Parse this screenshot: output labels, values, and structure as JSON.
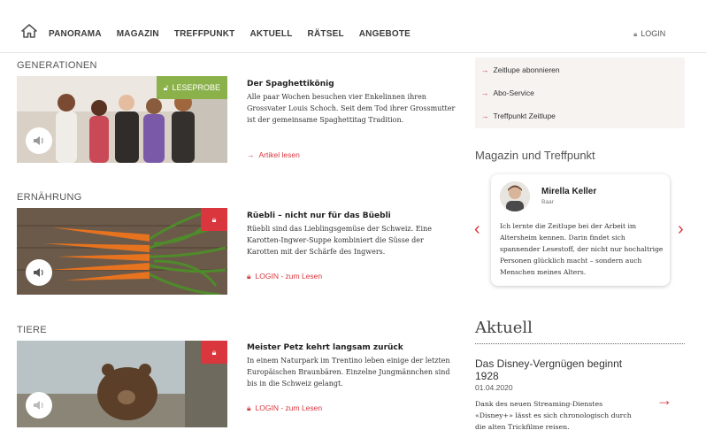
{
  "nav": {
    "items": [
      "PANORAMA",
      "MAGAZIN",
      "TREFFPUNKT",
      "AKTUELL",
      "RÄTSEL",
      "ANGEBOTE"
    ],
    "login": "LOGIN"
  },
  "articles": [
    {
      "category": "GENERATIONEN",
      "badge": "LESEPROBE",
      "title": "Der Spaghettikönig",
      "text": "Alle paar Wochen besuchen vier Enkelinnen ihren Grossvater Louis Schoch. Seit dem Tod ihrer Grossmutter ist der gemeinsame Spaghettitag Tradition.",
      "link": "Artikel lesen"
    },
    {
      "category": "ERNÄHRUNG",
      "title": "Rüebli – nicht nur für das Büebli",
      "text": "Rüebli sind das Lieblingsgemüse der Schweiz. Eine Karotten-Ingwer-Suppe kombiniert die Süsse der Karotten mit der Schärfe des Ingwers.",
      "link": "LOGIN - zum Lesen"
    },
    {
      "category": "TIERE",
      "title": "Meister Petz kehrt langsam zurück",
      "text": "In einem Naturpark im Trentino leben einige der letzten Europäischen Braunbären. Einzelne Jungmännchen sind bis in die Schweiz gelangt.",
      "link": "LOGIN - zum Lesen"
    }
  ],
  "sidebar": {
    "links": [
      "Zeitlupe abonnieren",
      "Abo-Service",
      "Treffpunkt Zeitlupe"
    ],
    "section_title_a": "Magazin",
    "section_title_und": "und",
    "section_title_b": "Treffpunkt",
    "card": {
      "name": "Mirella Keller",
      "place": "Baar",
      "quote": "Ich lernte die Zeitlupe bei der Arbeit im Altersheim kennen. Darin findet sich spannender Lesestoff, der nicht nur hochaltrige Personen glücklich macht – sondern auch Menschen meines Alters."
    }
  },
  "aktuell": {
    "title": "Aktuell",
    "headline": "Das Disney-Vergnügen beginnt 1928",
    "date": "01.04.2020",
    "text": "Dank des neuen Streaming-Dienstes «Disney+» lässt es sich chronologisch durch die alten Trickfilme reisen."
  },
  "colors": {
    "accent": "#d9363e",
    "badge_green": "#8bb24a",
    "sidebox_bg": "#f6f3f1"
  }
}
